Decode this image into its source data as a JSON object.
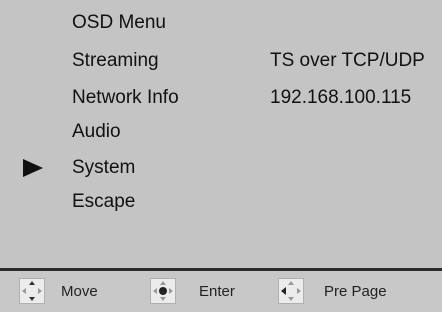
{
  "menu": {
    "title": "OSD Menu",
    "items": [
      {
        "label": "Streaming",
        "value": "TS over TCP/UDP"
      },
      {
        "label": "Network Info",
        "value": "192.168.100.115"
      },
      {
        "label": "Audio",
        "value": ""
      },
      {
        "label": "System",
        "value": "",
        "selected": true
      },
      {
        "label": "Escape",
        "value": ""
      }
    ]
  },
  "footer": {
    "items": [
      {
        "icon": "dpad-move-icon",
        "label": "Move"
      },
      {
        "icon": "dpad-enter-icon",
        "label": "Enter"
      },
      {
        "icon": "dpad-prev-page-icon",
        "label": "Pre Page"
      }
    ]
  },
  "colors": {
    "background": "#c4c4c4",
    "text": "#111111",
    "divider": "#2a2a2a"
  }
}
